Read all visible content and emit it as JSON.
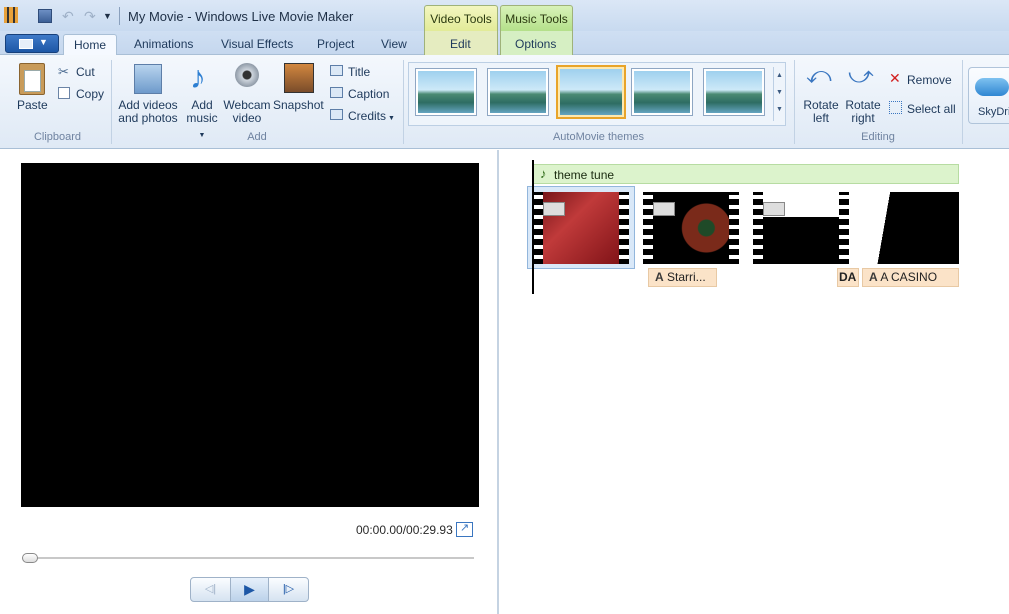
{
  "window": {
    "title": "My Movie - Windows Live Movie Maker"
  },
  "contextual": {
    "video_tools": "Video Tools",
    "music_tools": "Music Tools",
    "edit_tab": "Edit",
    "options_tab": "Options"
  },
  "tabs": [
    "Home",
    "Animations",
    "Visual Effects",
    "Project",
    "View"
  ],
  "clipboard": {
    "paste": "Paste",
    "cut": "Cut",
    "copy": "Copy",
    "group": "Clipboard"
  },
  "add": {
    "add_videos_line1": "Add videos",
    "add_videos_line2": "and photos",
    "add_music_line1": "Add",
    "add_music_line2": "music",
    "webcam_line1": "Webcam",
    "webcam_line2": "video",
    "snapshot": "Snapshot",
    "title": "Title",
    "caption": "Caption",
    "credits": "Credits",
    "group": "Add"
  },
  "themes": {
    "group": "AutoMovie themes"
  },
  "editing": {
    "rotate_left_line1": "Rotate",
    "rotate_left_line2": "left",
    "rotate_right_line1": "Rotate",
    "rotate_right_line2": "right",
    "remove": "Remove",
    "select_all": "Select all",
    "group": "Editing"
  },
  "share": {
    "skydrive": "SkyDriv"
  },
  "preview": {
    "timecode": "00:00.00/00:29.93"
  },
  "storyboard": {
    "music_track": "theme tune",
    "captions": [
      "Starri...",
      "A CASINO"
    ]
  },
  "colors": {
    "accent": "#1d57a6",
    "video_tools": "#e8efb0",
    "music_tools": "#bfe8a0"
  }
}
